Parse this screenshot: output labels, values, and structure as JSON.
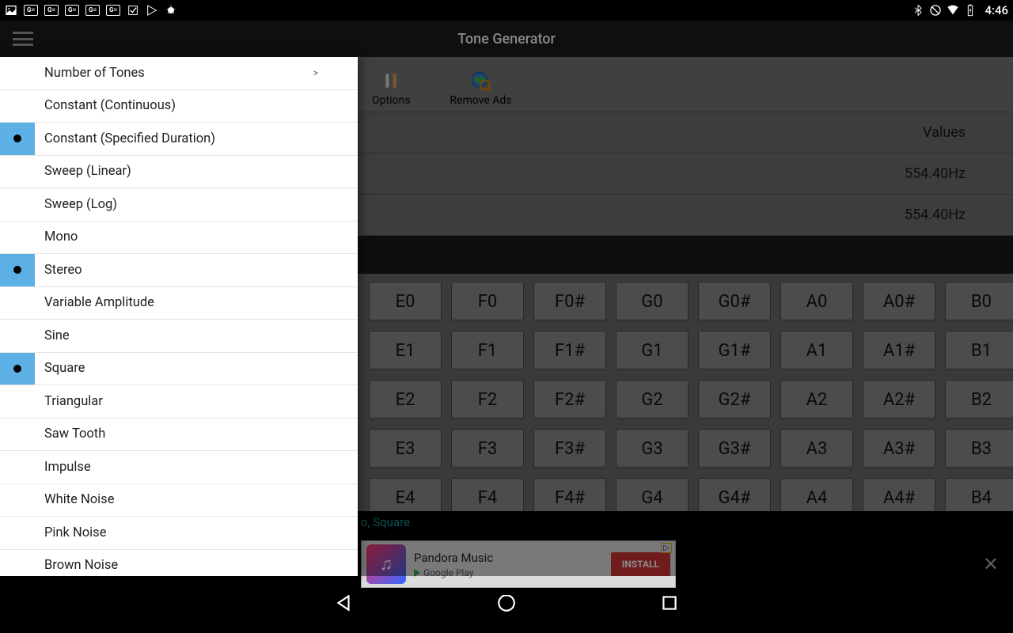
{
  "statusbar": {
    "clock": "4:46"
  },
  "titlebar": {
    "title": "Tone Generator"
  },
  "toolbar": {
    "options": "Options",
    "remove_ads": "Remove Ads"
  },
  "values": {
    "header": "Values",
    "freq1": "554.40Hz",
    "freq2": "554.40Hz"
  },
  "menu": {
    "items": [
      {
        "label": "Number of Tones",
        "selected": false,
        "chevron": true
      },
      {
        "label": "Constant (Continuous)",
        "selected": false
      },
      {
        "label": "Constant (Specified Duration)",
        "selected": true
      },
      {
        "label": "Sweep (Linear)",
        "selected": false
      },
      {
        "label": "Sweep (Log)",
        "selected": false
      },
      {
        "label": "Mono",
        "selected": false
      },
      {
        "label": "Stereo",
        "selected": true
      },
      {
        "label": "Variable Amplitude",
        "selected": false
      },
      {
        "label": "Sine",
        "selected": false
      },
      {
        "label": "Square",
        "selected": true
      },
      {
        "label": "Triangular",
        "selected": false
      },
      {
        "label": "Saw Tooth",
        "selected": false
      },
      {
        "label": "Impulse",
        "selected": false
      },
      {
        "label": "White Noise",
        "selected": false
      },
      {
        "label": "Pink Noise",
        "selected": false
      },
      {
        "label": "Brown Noise",
        "selected": false
      }
    ]
  },
  "keys": {
    "rows": [
      [
        "E0",
        "F0",
        "F0#",
        "G0",
        "G0#",
        "A0",
        "A0#",
        "B0"
      ],
      [
        "E1",
        "F1",
        "F1#",
        "G1",
        "G1#",
        "A1",
        "A1#",
        "B1"
      ],
      [
        "E2",
        "F2",
        "F2#",
        "G2",
        "G2#",
        "A2",
        "A2#",
        "B2"
      ],
      [
        "E3",
        "F3",
        "F3#",
        "G3",
        "G3#",
        "A3",
        "A3#",
        "B3"
      ],
      [
        "E4",
        "F4",
        "F4#",
        "G4",
        "G4#",
        "A4",
        "A4#",
        "B4"
      ]
    ]
  },
  "status_strip": "o, Square",
  "ad": {
    "title": "Pandora Music",
    "store": "Google Play",
    "cta": "INSTALL"
  }
}
